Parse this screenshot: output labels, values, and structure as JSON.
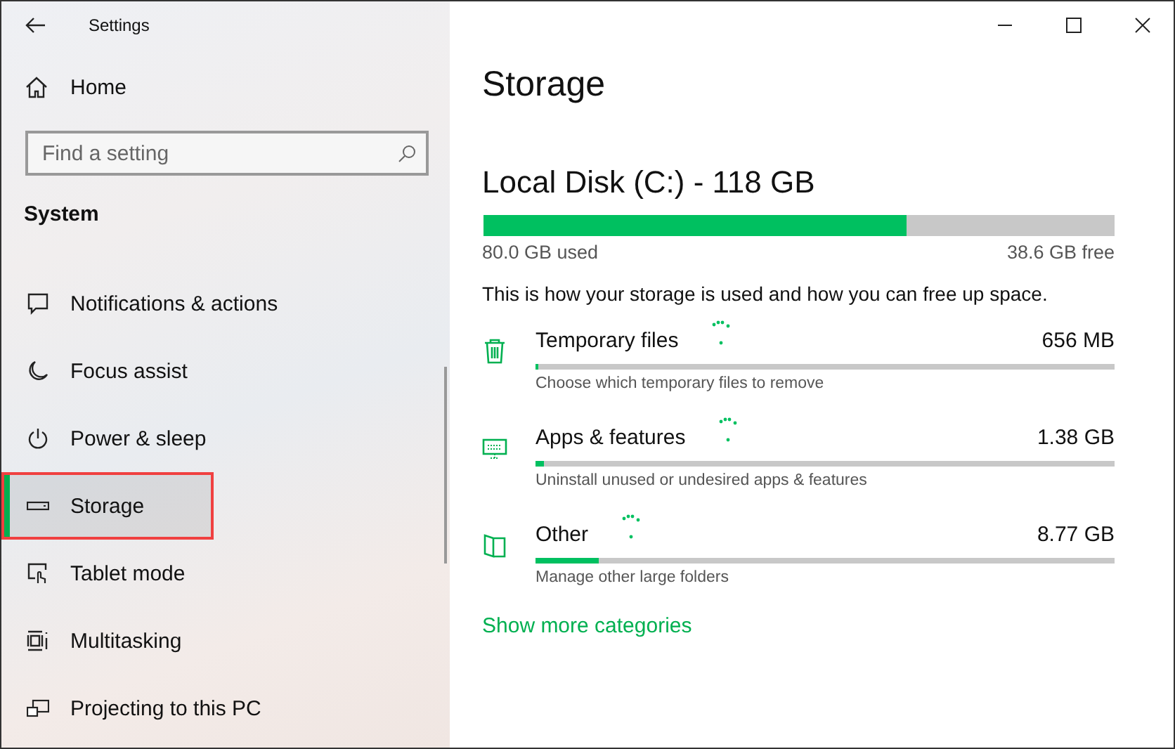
{
  "window": {
    "title": "Settings"
  },
  "sidebar": {
    "home": "Home",
    "search": {
      "placeholder": "Find a setting"
    },
    "section": "System",
    "items": [
      {
        "label": "Notifications & actions",
        "selected": false,
        "highlighted": false
      },
      {
        "label": "Focus assist",
        "selected": false,
        "highlighted": false
      },
      {
        "label": "Power & sleep",
        "selected": false,
        "highlighted": false
      },
      {
        "label": "Storage",
        "selected": true,
        "highlighted": true
      },
      {
        "label": "Tablet mode",
        "selected": false,
        "highlighted": false
      },
      {
        "label": "Multitasking",
        "selected": false,
        "highlighted": false
      },
      {
        "label": "Projecting to this PC",
        "selected": false,
        "highlighted": false
      }
    ]
  },
  "page": {
    "title": "Storage",
    "disk": {
      "name": "Local Disk (C:) - 118 GB",
      "level": 0.67,
      "used": "80.0 GB used",
      "free": "38.6 GB free"
    },
    "description": "This is how your storage is used and how you can free up space.",
    "categories": [
      {
        "name": "Temporary files",
        "size": "656 MB",
        "level": 0.006,
        "hint": "Choose which temporary files to remove",
        "loading": true
      },
      {
        "name": "Apps & features",
        "size": "1.38 GB",
        "level": 0.014,
        "hint": "Uninstall unused or undesired apps & features",
        "loading": true
      },
      {
        "name": "Other",
        "size": "8.77 GB",
        "level": 0.11,
        "hint": "Manage other large folders",
        "loading": true
      }
    ],
    "link": "Show more categories"
  }
}
